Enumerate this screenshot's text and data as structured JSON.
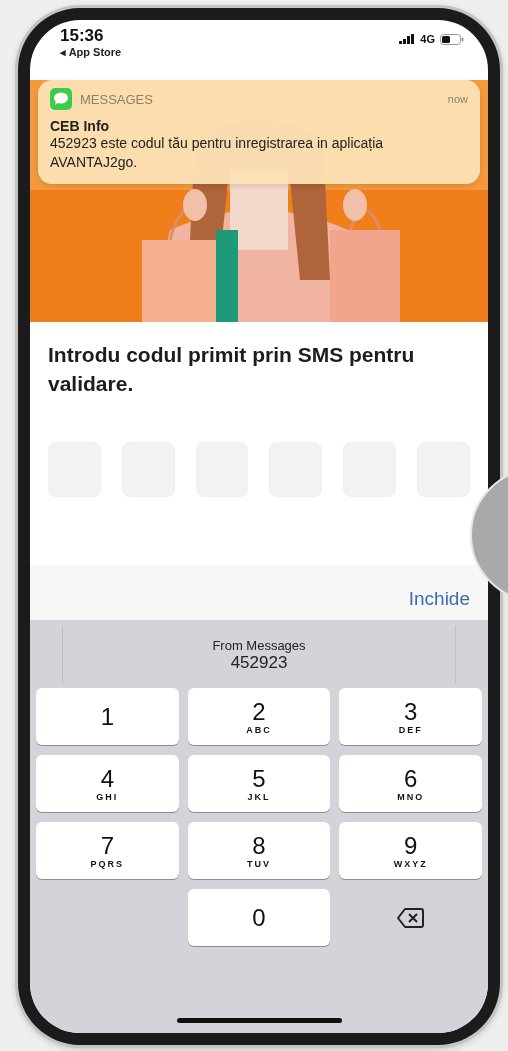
{
  "status_bar": {
    "time": "15:36",
    "back_label": "◂ App Store",
    "network": "4G"
  },
  "notification": {
    "app": "MESSAGES",
    "time": "now",
    "sender": "CEB Info",
    "message": "452923 este codul tău pentru inregistrarea in aplicația AVANTAJ2go."
  },
  "heading": "Introdu codul primit prin SMS pentru validare.",
  "code_fields": [
    {
      "filled": false
    },
    {
      "filled": false
    },
    {
      "filled": false
    },
    {
      "filled": false
    },
    {
      "filled": false
    },
    {
      "filled": false
    }
  ],
  "toolbar": {
    "done_label": "Inchide"
  },
  "keyboard": {
    "suggestion_source": "From Messages",
    "suggestion_code": "452923",
    "keys": [
      {
        "kind": "digit",
        "digit": "1"
      },
      {
        "kind": "digit",
        "digit": "2",
        "letters": "ABC"
      },
      {
        "kind": "digit",
        "digit": "3",
        "letters": "DEF"
      },
      {
        "kind": "digit",
        "digit": "4",
        "letters": "GHI"
      },
      {
        "kind": "digit",
        "digit": "5",
        "letters": "JKL"
      },
      {
        "kind": "digit",
        "digit": "6",
        "letters": "MNO"
      },
      {
        "kind": "digit",
        "digit": "7",
        "letters": "PQRS"
      },
      {
        "kind": "digit",
        "digit": "8",
        "letters": "TUV"
      },
      {
        "kind": "digit",
        "digit": "9",
        "letters": "WXYZ"
      },
      {
        "kind": "blank"
      },
      {
        "kind": "digit",
        "digit": "0"
      },
      {
        "kind": "delete"
      }
    ]
  }
}
